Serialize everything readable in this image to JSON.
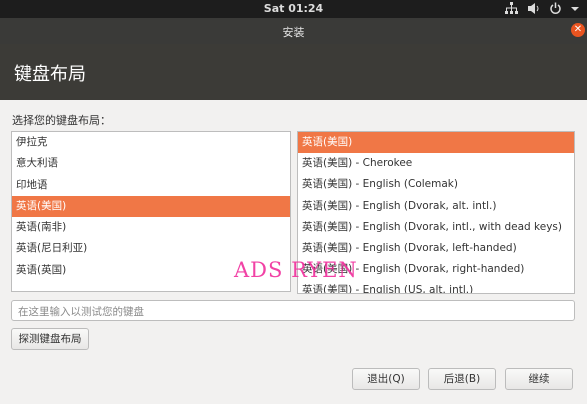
{
  "topbar": {
    "clock": "Sat 01:24"
  },
  "window": {
    "title": "安装",
    "header": "键盘布局"
  },
  "prompt": "选择您的键盘布局：",
  "left_list": [
    {
      "label": "伊拉克",
      "selected": false
    },
    {
      "label": "意大利语",
      "selected": false
    },
    {
      "label": "印地语",
      "selected": false
    },
    {
      "label": "英语(美国)",
      "selected": true
    },
    {
      "label": "英语(南非)",
      "selected": false
    },
    {
      "label": "英语(尼日利亚)",
      "selected": false
    },
    {
      "label": "英语(英国)",
      "selected": false
    }
  ],
  "right_list": [
    {
      "label": "英语(美国)",
      "selected": true
    },
    {
      "label": "英语(美国) - Cherokee",
      "selected": false
    },
    {
      "label": "英语(美国) - English (Colemak)",
      "selected": false
    },
    {
      "label": "英语(美国) - English (Dvorak, alt. intl.)",
      "selected": false
    },
    {
      "label": "英语(美国) - English (Dvorak, intl., with dead keys)",
      "selected": false
    },
    {
      "label": "英语(美国) - English (Dvorak, left-handed)",
      "selected": false
    },
    {
      "label": "英语(美国) - English (Dvorak, right-handed)",
      "selected": false
    },
    {
      "label": "英语(美国) - English (US, alt. intl.)",
      "selected": false
    }
  ],
  "test_input": {
    "placeholder": "在这里输入以测试您的键盘"
  },
  "buttons": {
    "detect": "探测键盘布局",
    "quit": "退出(Q)",
    "back": "后退(B)",
    "continue": "继续"
  },
  "watermark": "ADS RYEN",
  "colors": {
    "accent": "#f07746",
    "header_bg": "#3c3b37"
  }
}
